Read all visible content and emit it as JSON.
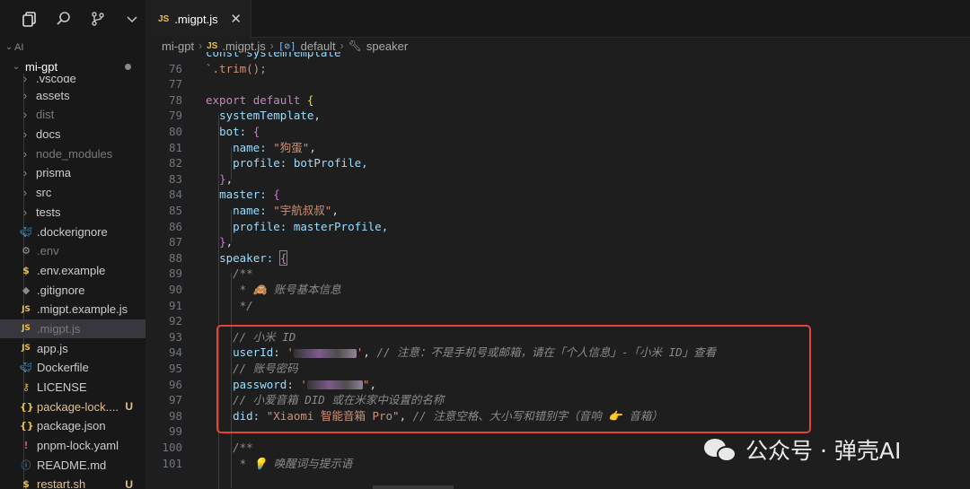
{
  "tab": {
    "icon": "JS",
    "title": ".migpt.js",
    "close": "✕"
  },
  "breadcrumb": {
    "folder": "mi-gpt",
    "file_icon": "JS",
    "file": ".migpt.js",
    "symbol_icon": "[⊘]",
    "symbol": "default",
    "member": "speaker"
  },
  "sidebar": {
    "section": "AI",
    "root": "mi-gpt",
    "items": [
      {
        "label": ".vscode",
        "icon": "›",
        "type": "folder"
      },
      {
        "label": "assets",
        "icon": "›",
        "type": "folder"
      },
      {
        "label": "dist",
        "icon": "›",
        "type": "folder-dim"
      },
      {
        "label": "docs",
        "icon": "›",
        "type": "folder"
      },
      {
        "label": "node_modules",
        "icon": "›",
        "type": "folder-dim"
      },
      {
        "label": "prisma",
        "icon": "›",
        "type": "folder"
      },
      {
        "label": "src",
        "icon": "›",
        "type": "folder"
      },
      {
        "label": "tests",
        "icon": "›",
        "type": "folder"
      },
      {
        "label": ".dockerignore",
        "icon": "docker-icon",
        "type": "file"
      },
      {
        "label": ".env",
        "icon": "gear-icon",
        "type": "file-dim"
      },
      {
        "label": ".env.example",
        "icon": "$",
        "type": "file"
      },
      {
        "label": ".gitignore",
        "icon": "diamond-icon",
        "type": "file"
      },
      {
        "label": ".migpt.example.js",
        "icon": "JS",
        "type": "file"
      },
      {
        "label": ".migpt.js",
        "icon": "JS",
        "type": "file-active"
      },
      {
        "label": "app.js",
        "icon": "JS",
        "type": "file"
      },
      {
        "label": "Dockerfile",
        "icon": "docker-icon",
        "type": "file"
      },
      {
        "label": "LICENSE",
        "icon": "license-icon",
        "type": "file"
      },
      {
        "label": "package-lock....",
        "icon": "{}",
        "type": "file-mod",
        "badge": "U"
      },
      {
        "label": "package.json",
        "icon": "{}",
        "type": "file"
      },
      {
        "label": "pnpm-lock.yaml",
        "icon": "!",
        "type": "file"
      },
      {
        "label": "README.md",
        "icon": "info-icon",
        "type": "file"
      },
      {
        "label": "restart.sh",
        "icon": "$",
        "type": "file-mod",
        "badge": "U"
      }
    ]
  },
  "editor": {
    "line_numbers": [
      "76",
      "77",
      "78",
      "79",
      "80",
      "81",
      "82",
      "83",
      "84",
      "85",
      "86",
      "87",
      "88",
      "89",
      "90",
      "91",
      "92",
      "93",
      "94",
      "95",
      "96",
      "97",
      "98",
      "99",
      "100",
      "101"
    ],
    "l75": "const systemTemplate",
    "l76": "`.trim();",
    "l78a": "export",
    "l78b": "default",
    "l79": "systemTemplate,",
    "l80": "bot:",
    "l81k": "name:",
    "l81v": "\"狗蛋\"",
    "l82k": "profile:",
    "l82v": "botProfile,",
    "l84": "master:",
    "l85k": "name:",
    "l85v": "\"宇航叔叔\"",
    "l86k": "profile:",
    "l86v": "masterProfile,",
    "l88": "speaker:",
    "l89": "/**",
    "l90": "* 🙈 账号基本信息",
    "l91": "*/",
    "l93": "// 小米 ID",
    "l94k": "userId:",
    "l94c": "// 注意：不是手机号或邮箱，请在「个人信息」-「小米 ID」查看",
    "l95": "// 账号密码",
    "l96k": "password:",
    "l97": "// 小爱音箱 DID 或在米家中设置的名称",
    "l98k": "did:",
    "l98v": "\"Xiaomi 智能音箱 Pro\"",
    "l98c": "// 注意空格、大小写和错别字（音响 👉 音箱）",
    "l100": "/**",
    "l101": "* 💡 唤醒词与提示语"
  },
  "watermark": {
    "text": "公众号 · 弹壳AI"
  },
  "colors": {
    "highlight": "#e0443a",
    "keyword": "#c586c0",
    "property": "#9cdcfe",
    "string": "#ce9178",
    "comment": "#6a9955"
  }
}
